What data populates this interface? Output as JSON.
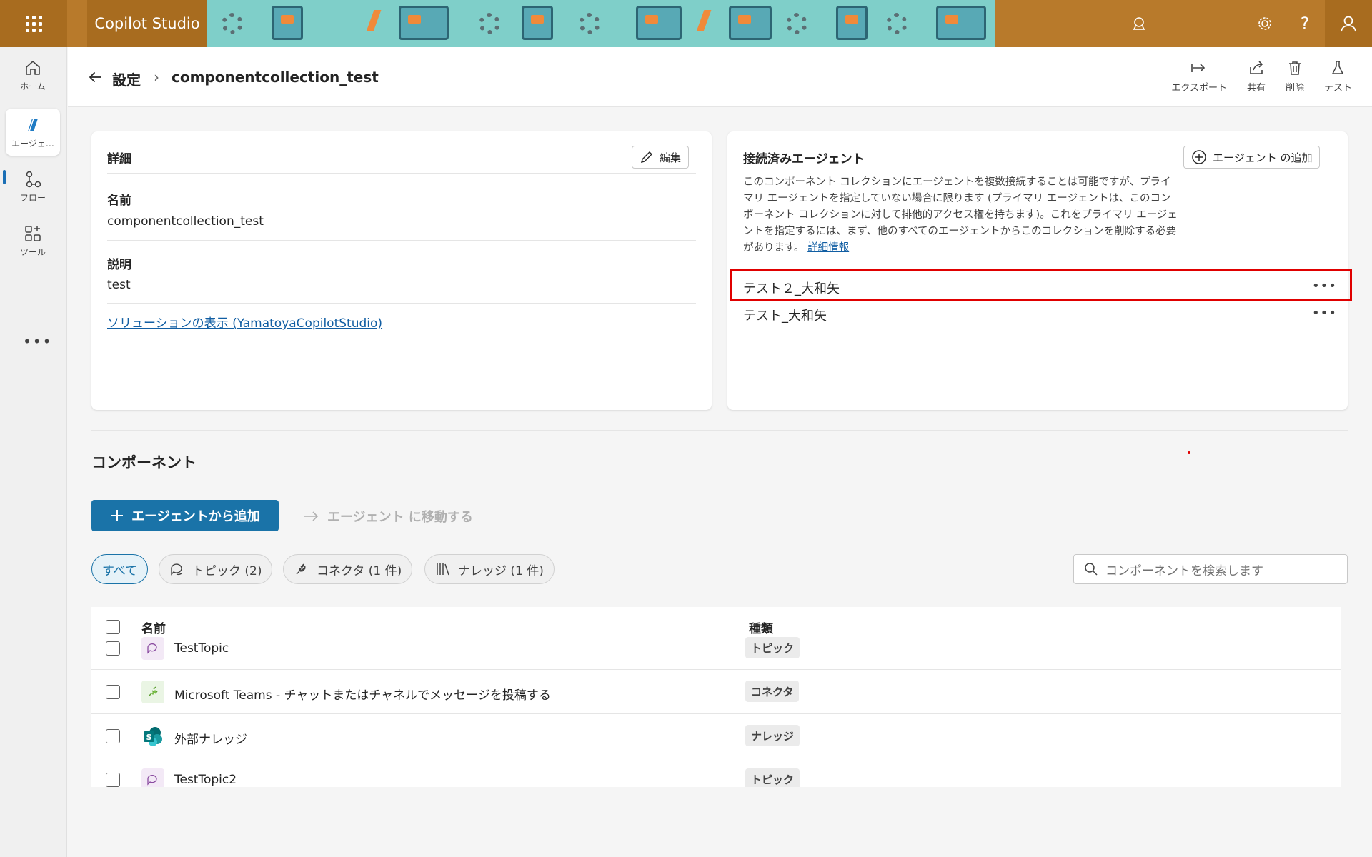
{
  "app": {
    "title": "Copilot Studio"
  },
  "rail": {
    "items": [
      {
        "label": "ホーム",
        "icon": "home-icon"
      },
      {
        "label": "エージェ…",
        "icon": "agent-icon"
      },
      {
        "label": "フロー",
        "icon": "flow-icon"
      },
      {
        "label": "ツール",
        "icon": "tools-icon"
      }
    ],
    "more": "•••"
  },
  "breadcrumb": {
    "parent": "設定",
    "separator": "›",
    "current": "componentcollection_test"
  },
  "toolbar": {
    "export": "エクスポート",
    "share": "共有",
    "delete": "削除",
    "test": "テスト"
  },
  "details": {
    "title": "詳細",
    "edit": "編集",
    "name_label": "名前",
    "name_value": "componentcollection_test",
    "desc_label": "説明",
    "desc_value": "test",
    "solution_link": "ソリューションの表示 (YamatoyaCopilotStudio)"
  },
  "connected": {
    "title": "接続済みエージェント",
    "add_button": "エージェント の追加",
    "description": "このコンポーネント コレクションにエージェントを複数接続することは可能ですが、プライマリ エージェントを指定していない場合に限ります (プライマリ エージェントは、このコンポーネント コレクションに対して排他的アクセス権を持ちます)。これをプライマリ エージェントを指定するには、まず、他のすべてのエージェントからこのコレクションを削除する必要があります。",
    "learn_more": "詳細情報",
    "agents": [
      "テスト２_大和矢",
      "テスト_大和矢"
    ],
    "more": "•••"
  },
  "components": {
    "title": "コンポーネント",
    "add_from_agent": "エージェントから追加",
    "move_to_agent": "エージェント に移動する",
    "filters": [
      "すべて",
      "トピック (2)",
      "コネクタ (1 件)",
      "ナレッジ (1 件)"
    ],
    "search_placeholder": "コンポーネントを検索します",
    "columns": {
      "name": "名前",
      "type": "種類"
    },
    "rows": [
      {
        "name": "TestTopic",
        "type": "トピック",
        "icon": "topic-icon"
      },
      {
        "name": "Microsoft Teams - チャットまたはチャネルでメッセージを投稿する",
        "type": "コネクタ",
        "icon": "connector-icon"
      },
      {
        "name": "外部ナレッジ",
        "type": "ナレッジ",
        "icon": "sharepoint-icon"
      },
      {
        "name": "TestTopic2",
        "type": "トピック",
        "icon": "topic-icon"
      }
    ]
  },
  "colors": {
    "topbar": "#b87a2b",
    "primary": "#1a73a8",
    "highlight": "#e00000",
    "link": "#115ea3"
  }
}
